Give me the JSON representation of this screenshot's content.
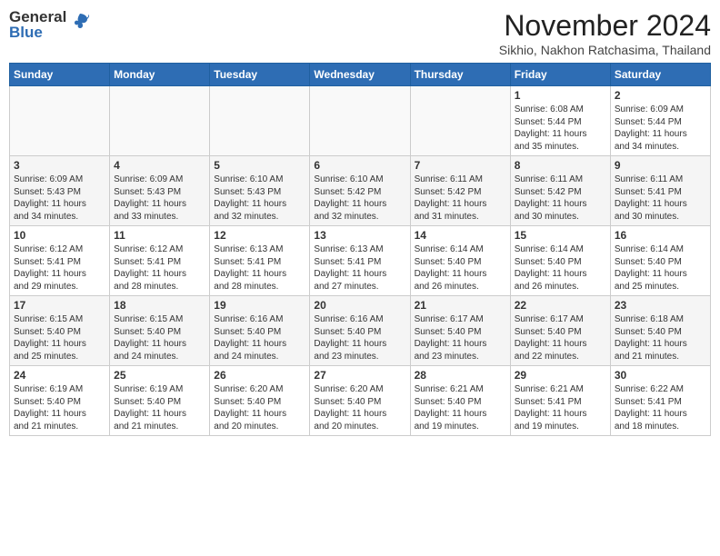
{
  "header": {
    "logo_general": "General",
    "logo_blue": "Blue",
    "month_year": "November 2024",
    "location": "Sikhio, Nakhon Ratchasima, Thailand"
  },
  "weekdays": [
    "Sunday",
    "Monday",
    "Tuesday",
    "Wednesday",
    "Thursday",
    "Friday",
    "Saturday"
  ],
  "weeks": [
    [
      {
        "day": "",
        "info": ""
      },
      {
        "day": "",
        "info": ""
      },
      {
        "day": "",
        "info": ""
      },
      {
        "day": "",
        "info": ""
      },
      {
        "day": "",
        "info": ""
      },
      {
        "day": "1",
        "info": "Sunrise: 6:08 AM\nSunset: 5:44 PM\nDaylight: 11 hours\nand 35 minutes."
      },
      {
        "day": "2",
        "info": "Sunrise: 6:09 AM\nSunset: 5:44 PM\nDaylight: 11 hours\nand 34 minutes."
      }
    ],
    [
      {
        "day": "3",
        "info": "Sunrise: 6:09 AM\nSunset: 5:43 PM\nDaylight: 11 hours\nand 34 minutes."
      },
      {
        "day": "4",
        "info": "Sunrise: 6:09 AM\nSunset: 5:43 PM\nDaylight: 11 hours\nand 33 minutes."
      },
      {
        "day": "5",
        "info": "Sunrise: 6:10 AM\nSunset: 5:43 PM\nDaylight: 11 hours\nand 32 minutes."
      },
      {
        "day": "6",
        "info": "Sunrise: 6:10 AM\nSunset: 5:42 PM\nDaylight: 11 hours\nand 32 minutes."
      },
      {
        "day": "7",
        "info": "Sunrise: 6:11 AM\nSunset: 5:42 PM\nDaylight: 11 hours\nand 31 minutes."
      },
      {
        "day": "8",
        "info": "Sunrise: 6:11 AM\nSunset: 5:42 PM\nDaylight: 11 hours\nand 30 minutes."
      },
      {
        "day": "9",
        "info": "Sunrise: 6:11 AM\nSunset: 5:41 PM\nDaylight: 11 hours\nand 30 minutes."
      }
    ],
    [
      {
        "day": "10",
        "info": "Sunrise: 6:12 AM\nSunset: 5:41 PM\nDaylight: 11 hours\nand 29 minutes."
      },
      {
        "day": "11",
        "info": "Sunrise: 6:12 AM\nSunset: 5:41 PM\nDaylight: 11 hours\nand 28 minutes."
      },
      {
        "day": "12",
        "info": "Sunrise: 6:13 AM\nSunset: 5:41 PM\nDaylight: 11 hours\nand 28 minutes."
      },
      {
        "day": "13",
        "info": "Sunrise: 6:13 AM\nSunset: 5:41 PM\nDaylight: 11 hours\nand 27 minutes."
      },
      {
        "day": "14",
        "info": "Sunrise: 6:14 AM\nSunset: 5:40 PM\nDaylight: 11 hours\nand 26 minutes."
      },
      {
        "day": "15",
        "info": "Sunrise: 6:14 AM\nSunset: 5:40 PM\nDaylight: 11 hours\nand 26 minutes."
      },
      {
        "day": "16",
        "info": "Sunrise: 6:14 AM\nSunset: 5:40 PM\nDaylight: 11 hours\nand 25 minutes."
      }
    ],
    [
      {
        "day": "17",
        "info": "Sunrise: 6:15 AM\nSunset: 5:40 PM\nDaylight: 11 hours\nand 25 minutes."
      },
      {
        "day": "18",
        "info": "Sunrise: 6:15 AM\nSunset: 5:40 PM\nDaylight: 11 hours\nand 24 minutes."
      },
      {
        "day": "19",
        "info": "Sunrise: 6:16 AM\nSunset: 5:40 PM\nDaylight: 11 hours\nand 24 minutes."
      },
      {
        "day": "20",
        "info": "Sunrise: 6:16 AM\nSunset: 5:40 PM\nDaylight: 11 hours\nand 23 minutes."
      },
      {
        "day": "21",
        "info": "Sunrise: 6:17 AM\nSunset: 5:40 PM\nDaylight: 11 hours\nand 23 minutes."
      },
      {
        "day": "22",
        "info": "Sunrise: 6:17 AM\nSunset: 5:40 PM\nDaylight: 11 hours\nand 22 minutes."
      },
      {
        "day": "23",
        "info": "Sunrise: 6:18 AM\nSunset: 5:40 PM\nDaylight: 11 hours\nand 21 minutes."
      }
    ],
    [
      {
        "day": "24",
        "info": "Sunrise: 6:19 AM\nSunset: 5:40 PM\nDaylight: 11 hours\nand 21 minutes."
      },
      {
        "day": "25",
        "info": "Sunrise: 6:19 AM\nSunset: 5:40 PM\nDaylight: 11 hours\nand 21 minutes."
      },
      {
        "day": "26",
        "info": "Sunrise: 6:20 AM\nSunset: 5:40 PM\nDaylight: 11 hours\nand 20 minutes."
      },
      {
        "day": "27",
        "info": "Sunrise: 6:20 AM\nSunset: 5:40 PM\nDaylight: 11 hours\nand 20 minutes."
      },
      {
        "day": "28",
        "info": "Sunrise: 6:21 AM\nSunset: 5:40 PM\nDaylight: 11 hours\nand 19 minutes."
      },
      {
        "day": "29",
        "info": "Sunrise: 6:21 AM\nSunset: 5:41 PM\nDaylight: 11 hours\nand 19 minutes."
      },
      {
        "day": "30",
        "info": "Sunrise: 6:22 AM\nSunset: 5:41 PM\nDaylight: 11 hours\nand 18 minutes."
      }
    ]
  ]
}
